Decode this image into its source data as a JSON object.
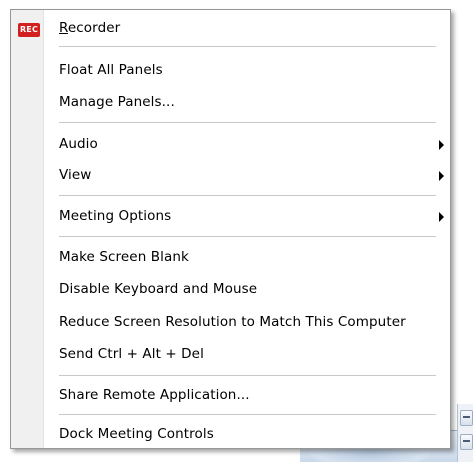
{
  "menu": {
    "recorder_icon": "REC",
    "recorder_mnemonic": "R",
    "recorder_rest": "ecorder",
    "items": [
      {
        "label": "Float All Panels"
      },
      {
        "label": "Manage Panels..."
      },
      {
        "label": "Audio"
      },
      {
        "label": "View"
      },
      {
        "label": "Meeting Options"
      },
      {
        "label": "Make Screen Blank"
      },
      {
        "label": "Disable Keyboard and Mouse"
      },
      {
        "label": "Reduce Screen Resolution to Match This Computer"
      },
      {
        "label": "Send Ctrl + Alt + Del"
      },
      {
        "label": "Share Remote Application..."
      },
      {
        "label": "Dock Meeting Controls"
      }
    ]
  }
}
